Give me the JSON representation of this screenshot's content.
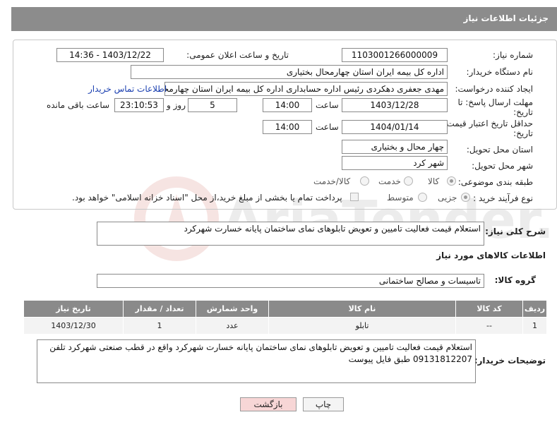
{
  "header": {
    "title": "جزئیات اطلاعات نیاز"
  },
  "need_number": {
    "label": "شماره نیاز:",
    "value": "1103001266000009"
  },
  "announce_datetime": {
    "label": "تاریخ و ساعت اعلان عمومی:",
    "value": "1403/12/22 - 14:36"
  },
  "buyer_org": {
    "label": "نام دستگاه خریدار:",
    "value": "اداره کل بیمه ایران استان چهارمحال بختیاری"
  },
  "requester": {
    "label": "ایجاد کننده درخواست:",
    "value": "مهدی جعفری دهکردی رئیس اداره حسابداری اداره کل بیمه ایران استان چهارمحال",
    "contact_link": "اطلاعات تماس خریدار"
  },
  "reply_deadline": {
    "label_line1": "مهلت ارسال پاسخ: تا",
    "label_line2": "تاریخ:",
    "date": "1403/12/28",
    "time_label": "ساعت",
    "time": "14:00",
    "days": "5",
    "days_label": "روز و",
    "remaining": "23:10:53",
    "remaining_label": "ساعت باقی مانده"
  },
  "price_validity": {
    "label_line1": "حداقل تاریخ اعتبار قیمت: تا",
    "label_line2": "تاریخ:",
    "date": "1404/01/14",
    "time_label": "ساعت",
    "time": "14:00"
  },
  "delivery_province": {
    "label": "استان محل تحویل:",
    "value": "چهار محال و بختیاری"
  },
  "delivery_city": {
    "label": "شهر محل تحویل:",
    "value": "شهر کرد"
  },
  "category": {
    "label": "طبقه بندی موضوعی:",
    "options": [
      "کالا",
      "خدمت",
      "کالا/خدمت"
    ],
    "selected": "کالا"
  },
  "purchase_process": {
    "label": "نوع فرآیند خرید :",
    "options": [
      "جزیی",
      "متوسط"
    ],
    "selected": "جزیی",
    "payment_text": "پرداخت تمام یا بخشی از مبلغ خرید،از محل \"اسناد خزانه اسلامی\" خواهد بود."
  },
  "general_description": {
    "label": "شرح کلی نیاز:",
    "value": "استعلام قیمت فعالیت تامیین و تعویض تابلوهای نمای ساختمان پایانه خسارت شهرکرد"
  },
  "goods_section": {
    "title": "اطلاعات کالاهای مورد نیاز"
  },
  "goods_group": {
    "label": "گروه کالا:",
    "value": "تاسیسات و مصالح ساختمانی"
  },
  "goods_table": {
    "headers": [
      "ردیف",
      "کد کالا",
      "نام کالا",
      "واحد شمارش",
      "تعداد / مقدار",
      "تاریخ نیاز"
    ],
    "rows": [
      [
        "1",
        "--",
        "تابلو",
        "عدد",
        "1",
        "1403/12/30"
      ]
    ]
  },
  "buyer_notes": {
    "label": "توضیحات خریدار:",
    "value": "استعلام قیمت فعالیت تامیین و تعویض تابلوهای نمای ساختمان پایانه خسارت شهرکرد  واقع در قطب صنعتی شهرکرد تلفن 09131812207 طبق فایل پیوست"
  },
  "actions": {
    "print": "چاپ",
    "back": "بازگشت"
  },
  "watermark": "AriaTender.net",
  "colors": {
    "header_bg": "#8c8c8c",
    "panel_border": "#c8c8c8",
    "link": "#1a3fb0",
    "back_button": "#f7d6d6"
  }
}
